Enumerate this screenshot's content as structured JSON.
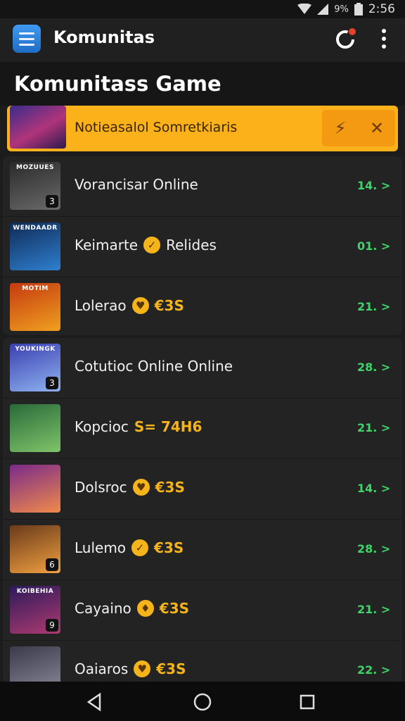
{
  "status_bar": {
    "battery_text": "9%",
    "time": "2:56"
  },
  "app_bar": {
    "title": "Komunitas"
  },
  "page": {
    "title": "Komunitass Game"
  },
  "banner": {
    "text": "Notieasalol Somretkiaris",
    "pin_icon": "pin-icon",
    "close_icon": "close-icon"
  },
  "group_a": [
    {
      "name": "Vorancisar Online",
      "chip": "",
      "chip_text": "",
      "extra": "",
      "score": "14. >",
      "thumb_tag": "MOZUUES",
      "badge": "3",
      "thumb_colors": [
        "#2a2a2a",
        "#6a6a6a"
      ]
    },
    {
      "name": "Keimarte",
      "chip": "✓",
      "chip_text": "Relides",
      "extra": "",
      "score": "01. >",
      "thumb_tag": "WENDAADR",
      "badge": "",
      "thumb_colors": [
        "#0f2a55",
        "#2f7fd1"
      ]
    },
    {
      "name": "Lolerao",
      "chip": "♥",
      "chip_text": "",
      "extra": "€3S",
      "score": "21. >",
      "thumb_tag": "MOTIM",
      "badge": "",
      "thumb_colors": [
        "#c53a10",
        "#f0a020"
      ]
    }
  ],
  "group_b": [
    {
      "name": "Cotutioc Online Online",
      "chip": "",
      "chip_text": "",
      "extra": "",
      "score": "28. >",
      "thumb_tag": "YOUKINGK",
      "badge": "3",
      "thumb_colors": [
        "#3a3fb0",
        "#8fb3f0"
      ]
    },
    {
      "name": "Kopcioc",
      "chip": "",
      "chip_text": "",
      "extra": "S= 74H6",
      "score": "21. >",
      "thumb_tag": "",
      "badge": "",
      "thumb_colors": [
        "#2a6a3a",
        "#7fc46a"
      ]
    },
    {
      "name": "Dolsroc",
      "chip": "♥",
      "chip_text": "",
      "extra": "€3S",
      "score": "14. >",
      "thumb_tag": "",
      "badge": "",
      "thumb_colors": [
        "#7a2a8a",
        "#f08a4a"
      ]
    },
    {
      "name": "Lulemo",
      "chip": "✓",
      "chip_text": "",
      "extra": "€3S",
      "score": "28. >",
      "thumb_tag": "",
      "badge": "6",
      "thumb_colors": [
        "#6a3a1a",
        "#f0a040"
      ]
    },
    {
      "name": "Cayaino",
      "chip": "♦",
      "chip_text": "",
      "extra": "€3S",
      "score": "21. >",
      "thumb_tag": "KOIBEHIA",
      "badge": "9",
      "thumb_colors": [
        "#2a1a5a",
        "#b03a70"
      ]
    },
    {
      "name": "Oaiaros",
      "chip": "♥",
      "chip_text": "",
      "extra": "€3S",
      "score": "22. >",
      "thumb_tag": "",
      "badge": "",
      "thumb_colors": [
        "#3a3a4a",
        "#8a8a9a"
      ]
    }
  ],
  "nav": {
    "back_icon": "back-icon",
    "home_icon": "home-icon",
    "recents_icon": "recents-icon"
  }
}
